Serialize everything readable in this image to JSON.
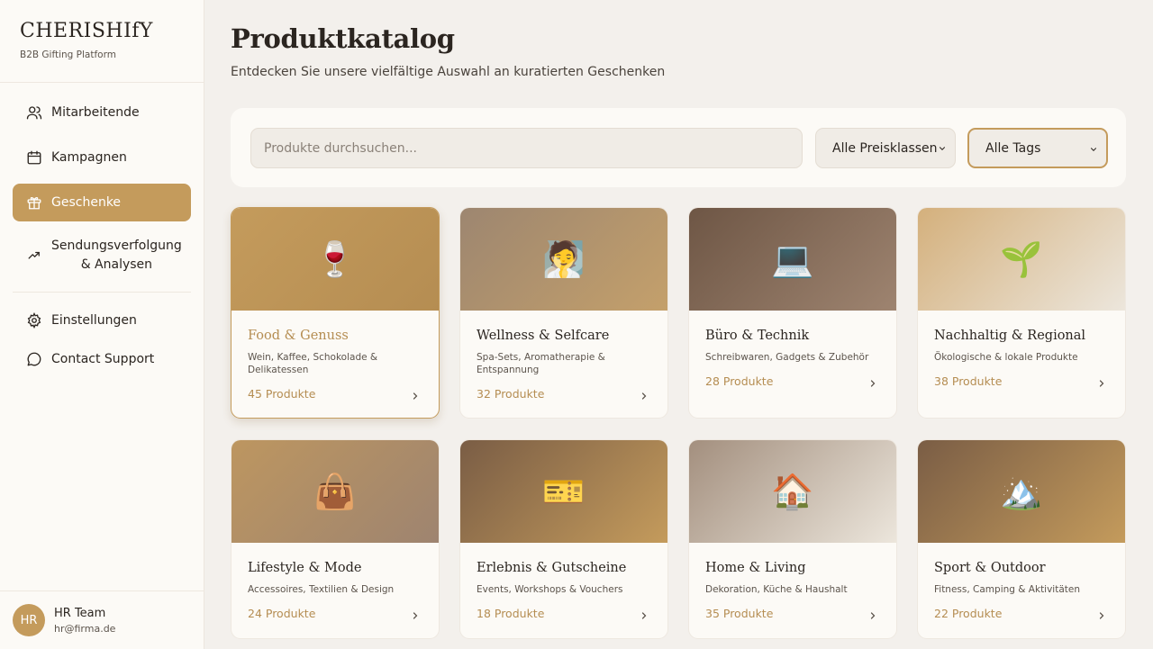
{
  "brand": {
    "name": "CHERISHIfY",
    "subtitle": "B2B Gifting Platform"
  },
  "nav": [
    {
      "label": "Mitarbeitende",
      "icon": "users-icon"
    },
    {
      "label": "Kampagnen",
      "icon": "calendar-icon"
    },
    {
      "label": "Geschenke",
      "icon": "gift-icon",
      "active": true
    },
    {
      "label": "Sendungsverfolgung & Analysen",
      "line1": "Sendungsverfolgung",
      "line2": "& Analysen",
      "icon": "trend-icon"
    }
  ],
  "nav_secondary": [
    {
      "label": "Einstellungen",
      "icon": "gear-icon"
    },
    {
      "label": "Contact Support",
      "icon": "chat-bubble-icon"
    }
  ],
  "user": {
    "initials": "HR",
    "name": "HR Team",
    "email": "hr@firma.de"
  },
  "page": {
    "title": "Produktkatalog",
    "subtitle": "Entdecken Sie unsere vielfältige Auswahl an kuratierten Geschenken"
  },
  "filters": {
    "search_placeholder": "Produkte durchsuchen...",
    "price_selected": "Alle Preisklassen",
    "tags_selected": "Alle Tags"
  },
  "categories": [
    {
      "name": "Food & Genuss",
      "desc": "Wein, Kaffee, Schokolade & Delikatessen",
      "count": "45 Produkte",
      "emoji": "🍷",
      "icon": "wine-glass-icon",
      "gradient": [
        "#c49b5c",
        "#b58d52"
      ],
      "featured": true
    },
    {
      "name": "Wellness & Selfcare",
      "desc": "Spa-Sets, Aromatherapie & Entspannung",
      "count": "32 Produkte",
      "emoji": "🧖",
      "icon": "spa-person-icon",
      "gradient": [
        "#9d8670",
        "#c4a06b"
      ]
    },
    {
      "name": "Büro & Technik",
      "desc": "Schreibwaren, Gadgets & Zubehör",
      "count": "28 Produkte",
      "emoji": "💻",
      "icon": "laptop-icon",
      "gradient": [
        "#6e5645",
        "#9e8470"
      ]
    },
    {
      "name": "Nachhaltig & Regional",
      "desc": "Ökologische & lokale Produkte",
      "count": "38 Produkte",
      "emoji": "🌱",
      "icon": "seedling-icon",
      "gradient": [
        "#d4b07c",
        "#ece6dc"
      ]
    },
    {
      "name": "Lifestyle & Mode",
      "desc": "Accessoires, Textilien & Design",
      "count": "24 Produkte",
      "emoji": "👜",
      "icon": "handbag-icon",
      "gradient": [
        "#bd9660",
        "#9e8470"
      ]
    },
    {
      "name": "Erlebnis & Gutscheine",
      "desc": "Events, Workshops & Vouchers",
      "count": "18 Produkte",
      "emoji": "🎫",
      "icon": "ticket-icon",
      "gradient": [
        "#7a5d45",
        "#c49b5c"
      ]
    },
    {
      "name": "Home & Living",
      "desc": "Dekoration, Küche & Haushalt",
      "count": "35 Produkte",
      "emoji": "🏠",
      "icon": "house-icon",
      "gradient": [
        "#a38f7e",
        "#ece6dc"
      ]
    },
    {
      "name": "Sport & Outdoor",
      "desc": "Fitness, Camping & Aktivitäten",
      "count": "22 Produkte",
      "emoji": "🏔️",
      "icon": "mountain-icon",
      "gradient": [
        "#7a5d45",
        "#c49b5c"
      ]
    }
  ],
  "colors": {
    "accent": "#c49b5c",
    "accent_text": "#b58d52",
    "background": "#f3f0ec",
    "surface": "#fcfaf6"
  }
}
